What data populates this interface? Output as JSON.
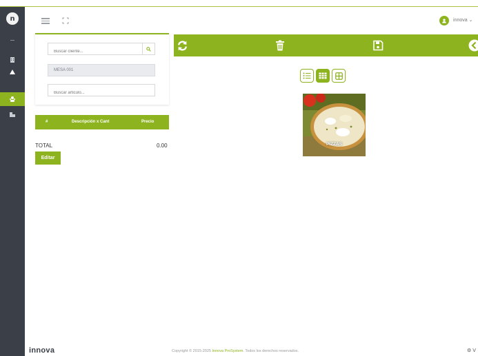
{
  "topbar": {
    "user_name": "innova ⌄"
  },
  "sidebar": {
    "logo_letter": "n",
    "items": [
      {
        "icon": "building-icon"
      },
      {
        "icon": "home-icon"
      },
      {
        "icon": "users-icon",
        "active": true
      },
      {
        "icon": "factory-icon"
      }
    ]
  },
  "client_panel": {
    "search_client_placeholder": "Buscar cliente...",
    "table_label": "MESA 001",
    "search_article_placeholder": "Buscar articulo..."
  },
  "order_table": {
    "columns": [
      "#",
      "Descripción x Cant",
      "Precio"
    ]
  },
  "summary": {
    "total_label": "TOTAL",
    "total_value": "0.00",
    "edit_label": "Editar"
  },
  "toolbar": {
    "icons": [
      "refresh-icon",
      "trash-icon",
      "save-icon",
      "back-icon"
    ]
  },
  "view_modes": [
    "list-view-icon",
    "grid-view-icon",
    "large-grid-view-icon"
  ],
  "categories": [
    {
      "label": "PIZZAS"
    }
  ],
  "footer": {
    "brand": "innova",
    "copyright_prefix": "Copyright © 2015-2025 ",
    "copyright_link": "Innova ProSystem",
    "copyright_suffix": ". Todos los derechos reservados.",
    "version": "⚙ V"
  },
  "colors": {
    "accent": "#8db31e",
    "sidebar": "#3a3f48"
  }
}
